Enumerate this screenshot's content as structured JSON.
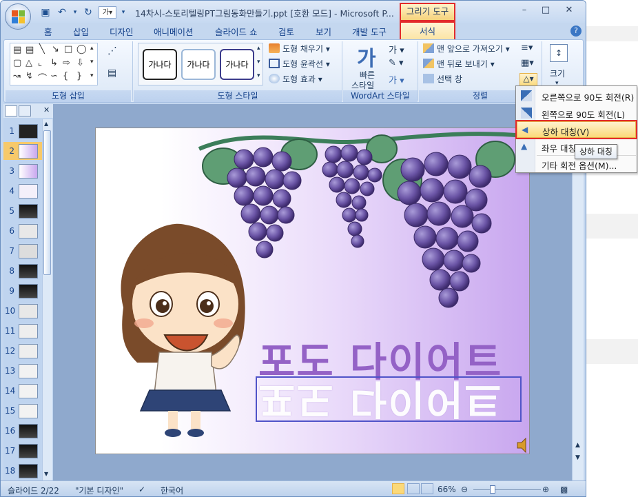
{
  "window": {
    "title": "14차시-스토리텔링PT그림동화만들기.ppt [호환 모드] - Microsoft P...",
    "context_tab_group": "그리기 도구",
    "controls": [
      "–",
      "□",
      "✕"
    ]
  },
  "quick_access": {
    "save_icon": "save-icon",
    "undo_icon": "undo-icon",
    "redo_icon": "redo-icon",
    "ga_label": "가"
  },
  "ribbon": {
    "tabs": [
      "홈",
      "삽입",
      "디자인",
      "애니메이션",
      "슬라이드 쇼",
      "검토",
      "보기",
      "개발 도구"
    ],
    "active_tab": "서식",
    "help": "?",
    "groups": {
      "insert_shape": "도형 삽입",
      "shape_styles": "도형 스타일",
      "wordart_styles": "WordArt 스타일",
      "arrange": "정렬",
      "size": "크기"
    },
    "style_samples": [
      "가나다",
      "가나다",
      "가나다"
    ],
    "shape_fill": "도형 채우기",
    "shape_outline": "도형 윤곽선",
    "shape_effects": "도형 효과",
    "quick_styles_line1": "빠른",
    "quick_styles_line2": "스타일",
    "wordart_ga": "가",
    "bring_front": "맨 앞으로 가져오기",
    "send_back": "맨 뒤로 보내기",
    "selection_pane": "선택 창",
    "size_button": "크기"
  },
  "rotate_menu": {
    "items": [
      "오른쪽으로 90도 회전(R)",
      "왼쪽으로 90도 회전(L)",
      "상하 대칭(V)",
      "좌우 대칭(H)",
      "기타 회전 옵션(M)..."
    ],
    "highlighted_index": 2,
    "tooltip": "상하 대칭"
  },
  "slides_pane": {
    "numbers": [
      "1",
      "2",
      "3",
      "4",
      "5",
      "6",
      "7",
      "8",
      "9",
      "10",
      "11",
      "12",
      "13",
      "14",
      "15",
      "16",
      "17",
      "18"
    ],
    "selected": "2"
  },
  "slide": {
    "title_text": "포도 다이어트",
    "flipped_text": "포도 다이어트"
  },
  "status_bar": {
    "slide_info": "슬라이드 2/22",
    "theme": "\"기본 디자인\"",
    "language": "한국어",
    "zoom": "66%"
  },
  "colors": {
    "accent_red": "#e32b2b",
    "ribbon_blue": "#15428b",
    "wordart_purple": "#9462c6"
  }
}
